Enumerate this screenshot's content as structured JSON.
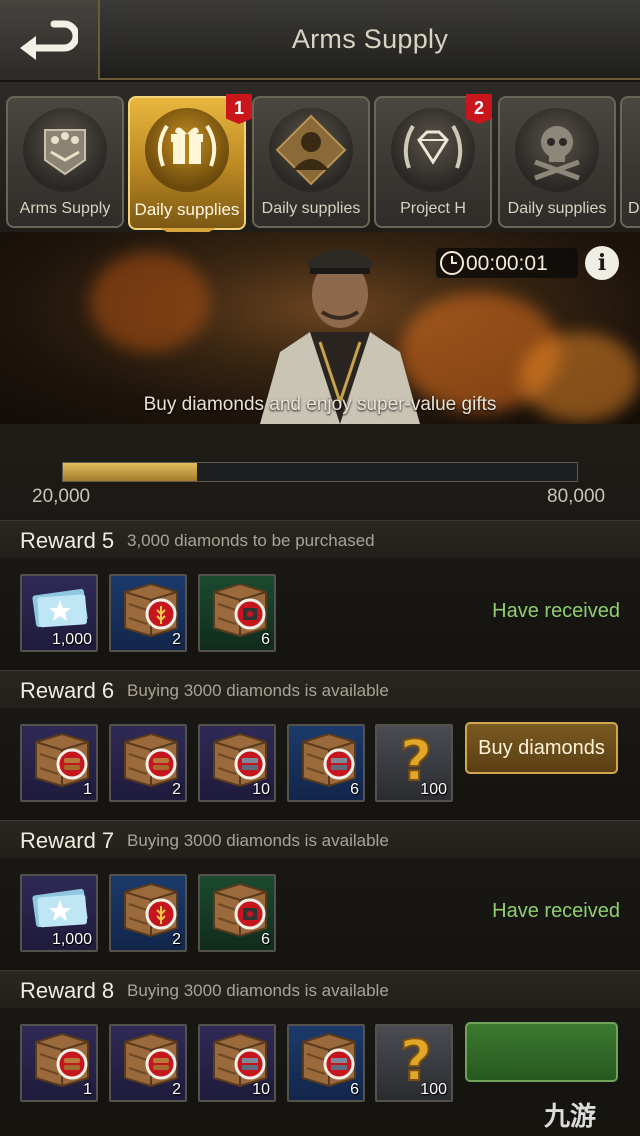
{
  "header": {
    "title": "Arms Supply",
    "back_icon": "back-arrow-icon"
  },
  "tabs": [
    {
      "label": "Arms Supply",
      "icon": "military-rank-icon",
      "active": false,
      "badge": ""
    },
    {
      "label": "Daily supplies",
      "icon": "gift-laurel-icon",
      "active": true,
      "badge": "1"
    },
    {
      "label": "Daily supplies",
      "icon": "officer-silhouette-icon",
      "active": false,
      "badge": ""
    },
    {
      "label": "Project H",
      "icon": "diamond-laurel-icon",
      "active": false,
      "badge": "2"
    },
    {
      "label": "Daily supplies",
      "icon": "skull-crossbones-icon",
      "active": false,
      "badge": ""
    },
    {
      "label": "Da",
      "icon": "",
      "active": false,
      "badge": ""
    }
  ],
  "banner": {
    "timer": "00:00:01",
    "info_label": "i",
    "caption": "Buy diamonds and enjoy super-value gifts"
  },
  "progress": {
    "min_label": "20,000",
    "max_label": "80,000",
    "fill_fraction": 0.26
  },
  "rewards": [
    {
      "title": "Reward 5",
      "subtitle": "3,000 diamonds to be purchased",
      "status": "Have received",
      "action": "received",
      "items": [
        {
          "type": "ticket",
          "tier": "purple",
          "qty": "1,000"
        },
        {
          "type": "crate-wheat",
          "tier": "blue",
          "qty": "2"
        },
        {
          "type": "crate-supply",
          "tier": "green",
          "qty": "6"
        }
      ]
    },
    {
      "title": "Reward 6",
      "subtitle": "Buying 3000 diamonds is available",
      "status": "Buy diamonds",
      "action": "buy",
      "items": [
        {
          "type": "crate-wood",
          "tier": "purple",
          "qty": "1"
        },
        {
          "type": "crate-wood",
          "tier": "purple",
          "qty": "2"
        },
        {
          "type": "crate-steel",
          "tier": "purple",
          "qty": "10"
        },
        {
          "type": "crate-steel",
          "tier": "blue",
          "qty": "6"
        },
        {
          "type": "mystery",
          "tier": "gray",
          "qty": "100"
        }
      ]
    },
    {
      "title": "Reward 7",
      "subtitle": "Buying 3000 diamonds is available",
      "status": "Have received",
      "action": "received",
      "items": [
        {
          "type": "ticket",
          "tier": "purple",
          "qty": "1,000"
        },
        {
          "type": "crate-wheat",
          "tier": "blue",
          "qty": "2"
        },
        {
          "type": "crate-supply",
          "tier": "green",
          "qty": "6"
        }
      ]
    },
    {
      "title": "Reward 8",
      "subtitle": "Buying 3000 diamonds is available",
      "status": "",
      "action": "buy-green",
      "items": [
        {
          "type": "crate-wood",
          "tier": "purple",
          "qty": "1"
        },
        {
          "type": "crate-wood",
          "tier": "purple",
          "qty": "2"
        },
        {
          "type": "crate-steel",
          "tier": "purple",
          "qty": "10"
        },
        {
          "type": "crate-steel",
          "tier": "blue",
          "qty": "6"
        },
        {
          "type": "mystery",
          "tier": "gray",
          "qty": "100"
        }
      ]
    }
  ],
  "watermark": "九游"
}
